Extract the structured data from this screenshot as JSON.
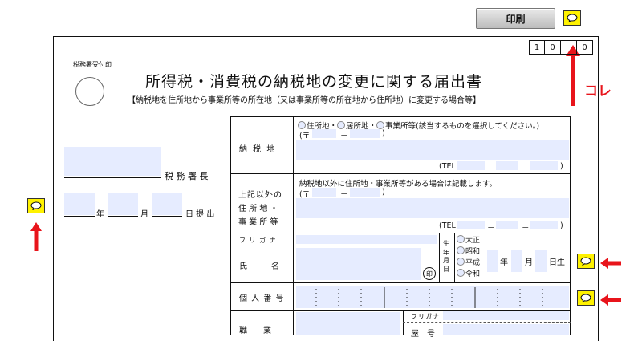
{
  "toolbar": {
    "print_label": "印刷"
  },
  "annotation": {
    "kore_label": "コレ"
  },
  "form": {
    "receipt_stamp_label": "税務署受付印",
    "office_number": [
      "1",
      "0",
      "",
      "0"
    ],
    "title": "所得税・消費税の納税地の変更に関する届出書",
    "subtitle": "【納税地を住所地から事業所等の所在地（又は事業所等の所在地から住所地）に変更する場合等】",
    "tax_office_suffix": "税 務 署 長",
    "date": {
      "year": "年",
      "month": "月",
      "day": "日 提 出"
    },
    "nozeichi": {
      "label": "納 税 地",
      "opt1": "住所地・",
      "opt2": "居所地・",
      "opt3": "事業所等(該当するものを選択してください。)",
      "postal_prefix": "(〒",
      "postal_dash": "－",
      "postal_close": ")",
      "tel_prefix": "(TEL",
      "tel_dash1": "－",
      "tel_dash2": "－",
      "tel_close": ")"
    },
    "other_address": {
      "label_line1": "上記以外の",
      "label_line2": "住 所 地 ・",
      "label_line3": "事 業 所 等",
      "note": "納税地以外に住所地・事業所等がある場合は記載します。",
      "postal_prefix": "(〒",
      "postal_dash": "－",
      "postal_close": ")",
      "tel_prefix": "(TEL",
      "tel_dash1": "－",
      "tel_dash2": "－",
      "tel_close": ")"
    },
    "name": {
      "furigana": "フ リ ガ ナ",
      "label": "氏　　　名",
      "seal": "印"
    },
    "birth": {
      "label": [
        "生",
        "年",
        "月",
        "日"
      ],
      "eras": [
        "大正",
        "昭和",
        "平成",
        "令和"
      ],
      "year": "年",
      "month": "月",
      "day": "日生"
    },
    "my_number": {
      "label": "個 人 番 号"
    },
    "occupation": {
      "label": "職　　業",
      "furigana": "フリガナ",
      "shop_label": "屋　号"
    }
  }
}
